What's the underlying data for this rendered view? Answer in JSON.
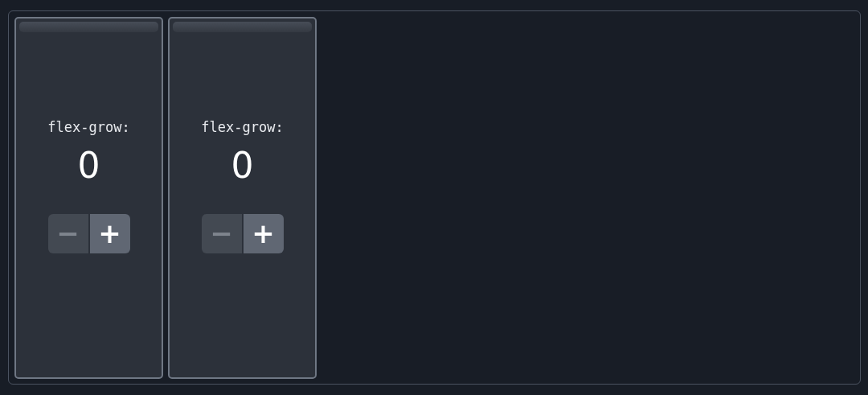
{
  "items": [
    {
      "label": "flex-grow:",
      "value": "0",
      "buttons": [
        {
          "symbol": "−",
          "disabled": true
        },
        {
          "symbol": "+",
          "disabled": false
        }
      ]
    },
    {
      "label": "flex-grow:",
      "value": "0",
      "buttons": [
        {
          "symbol": "−",
          "disabled": true
        },
        {
          "symbol": "+",
          "disabled": false
        }
      ]
    }
  ]
}
